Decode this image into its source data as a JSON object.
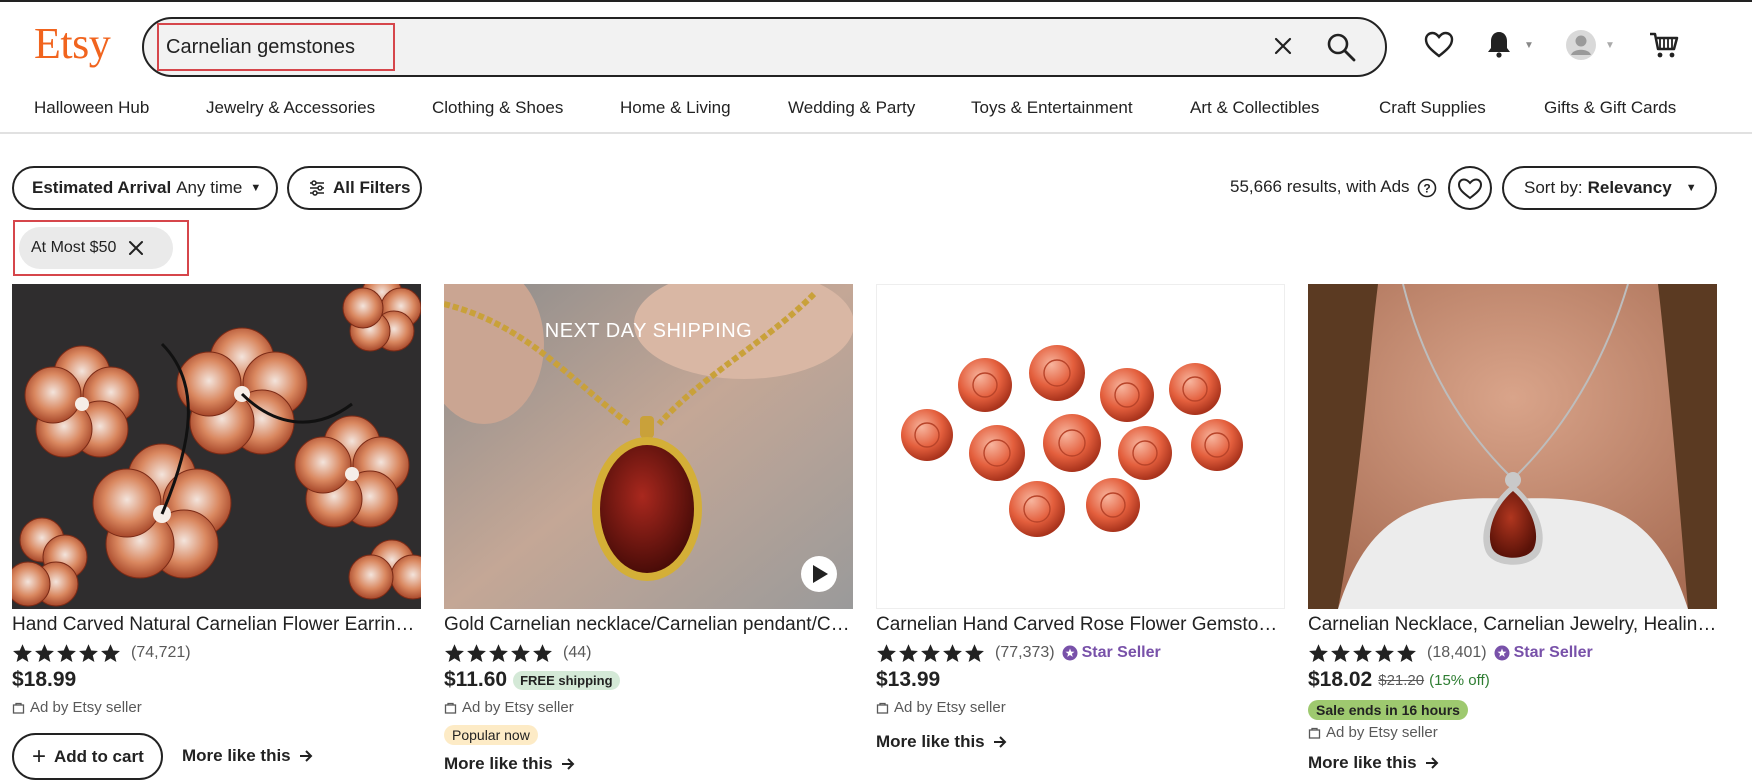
{
  "header": {
    "logo": "Etsy",
    "search_value": "Carnelian gemstones"
  },
  "categories": [
    "Halloween Hub",
    "Jewelry & Accessories",
    "Clothing & Shoes",
    "Home & Living",
    "Wedding & Party",
    "Toys & Entertainment",
    "Art & Collectibles",
    "Craft Supplies",
    "Gifts & Gift Cards"
  ],
  "filters": {
    "arrival_label": "Estimated Arrival",
    "arrival_value": "Any time",
    "all_filters": "All Filters",
    "results_text": "55,666 results, with Ads",
    "sort_label": "Sort by:",
    "sort_value": "Relevancy",
    "active_chip": "At Most $50"
  },
  "listings": [
    {
      "title": "Hand Carved Natural Carnelian Flower Earring Beads",
      "rating": 5,
      "reviews": "(74,721)",
      "price": "$18.99",
      "ad_text": "Ad by Etsy seller",
      "add_to_cart": "Add to cart",
      "more_like_this": "More like this"
    },
    {
      "title": "Gold Carnelian necklace/Carnelian pendant/Carnelian",
      "rating": 5,
      "reviews": "(44)",
      "price": "$11.60",
      "free_shipping": "FREE shipping",
      "ad_text": "Ad by Etsy seller",
      "popular": "Popular now",
      "overlay": "NEXT DAY SHIPPING",
      "more_like_this": "More like this"
    },
    {
      "title": "Carnelian Hand Carved Rose Flower Gemstone Beads",
      "rating": 5,
      "reviews": "(77,373)",
      "star_seller": "Star Seller",
      "price": "$13.99",
      "ad_text": "Ad by Etsy seller",
      "more_like_this": "More like this"
    },
    {
      "title": "Carnelian Necklace, Carnelian Jewelry, Healing Crystal",
      "rating": 5,
      "reviews": "(18,401)",
      "star_seller": "Star Seller",
      "price": "$18.02",
      "original_price": "$21.20",
      "discount": "(15% off)",
      "sale": "Sale ends in 16 hours",
      "ad_text": "Ad by Etsy seller",
      "more_like_this": "More like this"
    }
  ],
  "colors": {
    "brand": "#F1641E",
    "highlight": "#d6464b",
    "star_seller": "#7851a9",
    "free_shipping_bg": "#d4e9d7",
    "sale_bg": "#9ec96f",
    "popular_bg": "#fdebc6"
  }
}
